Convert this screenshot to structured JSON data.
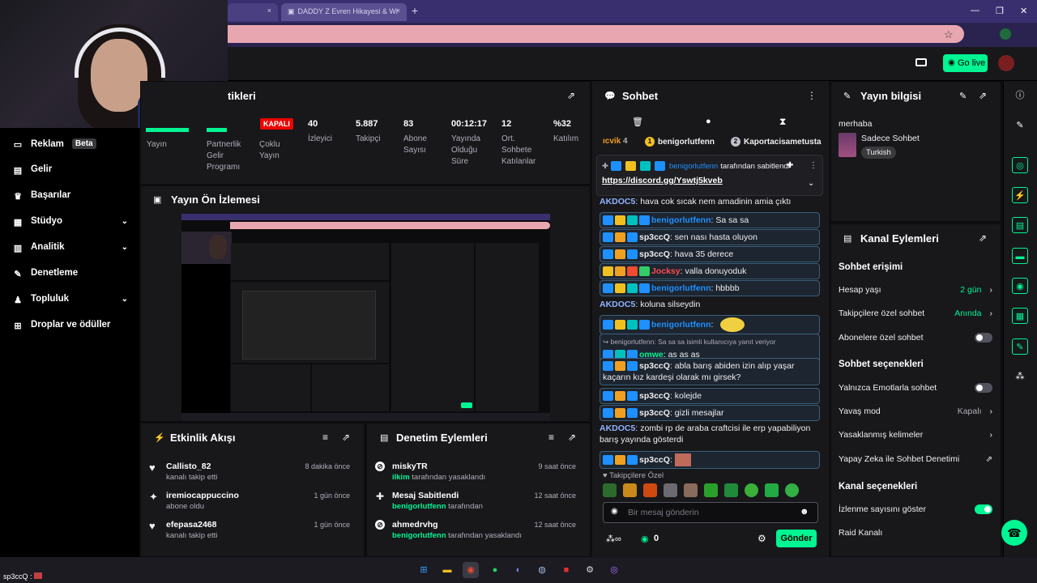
{
  "browser": {
    "tabs": [
      "",
      "DADDY Z Evren Hikayesi & Wi"
    ],
    "close": "×",
    "new_tab": "+",
    "win_min": "—",
    "win_max": "❐",
    "win_close": "✕",
    "star": "☆"
  },
  "topbar": {
    "go_live": "Go live"
  },
  "sidebar": {
    "items": [
      {
        "label": "Reklam",
        "badge": "Beta",
        "icon": "ad-icon"
      },
      {
        "label": "Gelir",
        "icon": "revenue-icon"
      },
      {
        "label": "Başarılar",
        "icon": "trophy-icon"
      },
      {
        "label": "Stüdyo",
        "icon": "studio-icon",
        "chevron": "⌄"
      },
      {
        "label": "Analitik",
        "icon": "analytics-icon",
        "chevron": "⌄"
      },
      {
        "label": "Denetleme",
        "icon": "moderation-icon"
      },
      {
        "label": "Topluluk",
        "icon": "community-icon",
        "chevron": "⌄"
      },
      {
        "label": "Droplar ve ödüller",
        "icon": "drops-icon"
      }
    ]
  },
  "stats_panel": {
    "title": "tikleri",
    "status_badge": "KAPALI",
    "stats": [
      {
        "value": "",
        "label": "Yayın"
      },
      {
        "value": "",
        "label": "Partnerlik Gelir Programı"
      },
      {
        "value": "",
        "label": "Çoklu Yayın"
      },
      {
        "value": "40",
        "label": "İzleyici"
      },
      {
        "value": "5.887",
        "label": "Takipçi"
      },
      {
        "value": "83",
        "label": "Abone Sayısı"
      },
      {
        "value": "00:12:17",
        "label": "Yayında Olduğu Süre"
      },
      {
        "value": "12",
        "label": "Ort. Sohbete Katılanlar"
      },
      {
        "value": "%32",
        "label": "Katılım"
      }
    ]
  },
  "preview_panel": {
    "title": "Yayın Ön İzlemesi"
  },
  "activity_panel": {
    "title": "Etkinlik Akışı",
    "items": [
      {
        "name": "Callisto_82",
        "sub": "kanalı takip etti",
        "time": "8 dakika önce",
        "icon": "heart-icon"
      },
      {
        "name": "iremiocappuccino",
        "sub": "abone oldu",
        "time": "1 gün önce",
        "icon": "sparkle-icon"
      },
      {
        "name": "efepasa2468",
        "sub": "kanalı takip etti",
        "time": "1 gün önce",
        "icon": "heart-icon"
      }
    ]
  },
  "mod_panel": {
    "title": "Denetim Eylemleri",
    "items": [
      {
        "name": "miskyTR",
        "who": "ilkim",
        "sub": "tarafından yasaklandı",
        "time": "9 saat önce",
        "icon": "ban-icon"
      },
      {
        "name": "Mesaj Sabitlendi",
        "who": "benigorlutfenn",
        "sub": "tarafından",
        "time": "12 saat önce",
        "icon": "pin-icon"
      },
      {
        "name": "ahmedrvhg",
        "who": "benigorlutfenn",
        "sub": "tarafından yasaklandı",
        "time": "12 saat önce",
        "icon": "ban-icon"
      }
    ]
  },
  "chat": {
    "title": "Sohbet",
    "leaderboard": [
      {
        "name": "ıcvik",
        "count": "4"
      },
      {
        "name": "benigorlutfenn",
        "rank": "1"
      },
      {
        "name": "Kaportacisametusta",
        "rank": "2"
      }
    ],
    "pinned": {
      "by": "benigorlutfenn",
      "by_text": "tarafından sabitlendi",
      "link": "https://discord.gg/Yswtj5kveb"
    },
    "messages": [
      {
        "user": "AKDOC5",
        "text": "hava cok sıcak nem amadinin amia çıktı",
        "color": "#8fb3ff",
        "hl": false
      },
      {
        "user": "benigorlutfenn",
        "text": "Sa sa sa",
        "color": "#1e90ff",
        "hl": true
      },
      {
        "user": "sp3ccQ",
        "text": "sen nası hasta oluyon",
        "color": "#efeff1",
        "hl": true
      },
      {
        "user": "sp3ccQ",
        "text": "hava 35 derece",
        "color": "#efeff1",
        "hl": true
      },
      {
        "user": "Jocksy",
        "text": "valla donuyoduk",
        "color": "#ff4d4d",
        "hl": true
      },
      {
        "user": "benigorlutfenn",
        "text": "hbbbb",
        "color": "#1e90ff",
        "hl": true
      },
      {
        "user": "AKDOC5",
        "text": "koluna silseydin",
        "color": "#8fb3ff",
        "hl": false
      },
      {
        "user": "benigorlutfenn",
        "text": "",
        "color": "#1e90ff",
        "hl": true
      },
      {
        "user": "omwe",
        "text": "as as as",
        "color": "#00f593",
        "hl": true,
        "reply": "benigorlutfenn: Sa sa sa isimli kullanıcıya yanıt veriyor"
      },
      {
        "user": "sp3ccQ",
        "text": "abla barış abiden izin alıp yaşar kaçarın kız kardeşi olarak mı girsek?",
        "color": "#efeff1",
        "hl": true
      },
      {
        "user": "sp3ccQ",
        "text": "kolejde",
        "color": "#efeff1",
        "hl": true
      },
      {
        "user": "sp3ccQ",
        "text": "gizli mesajlar",
        "color": "#efeff1",
        "hl": true
      },
      {
        "user": "AKDOC5",
        "text": "zombi rp de araba craftcisi ile erp yapabiliyon barış yayında gösterdi",
        "color": "#8fb3ff",
        "hl": false
      },
      {
        "user": "sp3ccQ",
        "text": "",
        "color": "#efeff1",
        "hl": true
      }
    ],
    "emote_label": "Takipçilere Özel",
    "input_placeholder": "Bir mesaj gönderin",
    "points": "0",
    "send": "Gönder"
  },
  "stream_info": {
    "title": "Yayın bilgisi",
    "stream_title": "merhaba",
    "category": "Sadece Sohbet",
    "tag": "Turkish"
  },
  "channel_actions": {
    "title": "Kanal Eylemleri",
    "chat_access": "Sohbet erişimi",
    "account_age": {
      "label": "Hesap yaşı",
      "value": "2 gün"
    },
    "followers_only": {
      "label": "Takipçilere özel sohbet",
      "value": "Anında"
    },
    "subs_only": {
      "label": "Abonelere özel sohbet",
      "on": false
    },
    "chat_options": "Sohbet seçenekleri",
    "emote_only": {
      "label": "Yalnızca Emotlarla sohbet",
      "on": false
    },
    "slow_mode": {
      "label": "Yavaş mod",
      "value": "Kapalı"
    },
    "blocked_terms": {
      "label": "Yasaklanmış kelimeler"
    },
    "ai_mod": {
      "label": "Yapay Zeka ile Sohbet Denetimi"
    },
    "channel_options": "Kanal seçenekleri",
    "viewer_count": {
      "label": "İzlenme sayısını göster",
      "on": true
    },
    "raid": {
      "label": "Raid Kanalı"
    }
  },
  "taskbar": {
    "user_label": "sp3ccQ :"
  },
  "colors": {
    "accent": "#00f593",
    "bg": "#0e0e10",
    "panel": "#18181b",
    "danger": "#eb0400"
  }
}
